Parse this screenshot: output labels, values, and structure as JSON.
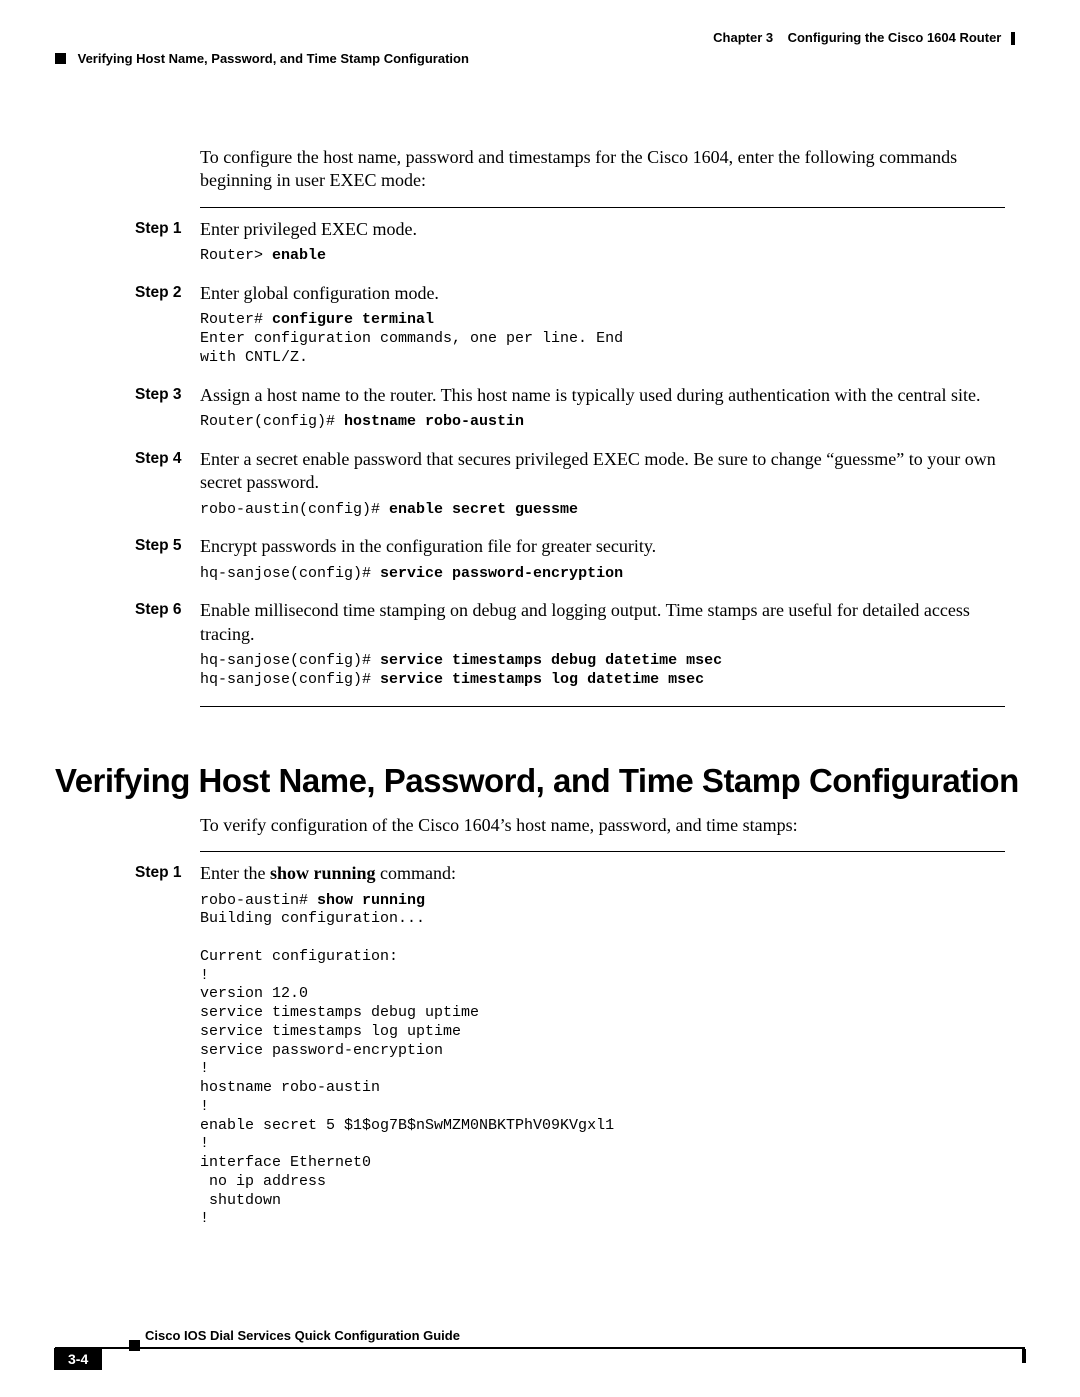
{
  "header": {
    "chapter_label": "Chapter 3",
    "chapter_title": "Configuring the Cisco 1604 Router",
    "section_crumb": "Verifying Host Name, Password, and Time Stamp Configuration"
  },
  "intro_para": "To configure the host name, password and timestamps for the Cisco 1604, enter the following commands beginning in user EXEC mode:",
  "steps1": [
    {
      "label": "Step 1",
      "text": "Enter privileged EXEC mode.",
      "code_prefix": "Router> ",
      "code_bold": "enable",
      "code_suffix": ""
    },
    {
      "label": "Step 2",
      "text": "Enter global configuration mode.",
      "code_prefix": "Router# ",
      "code_bold": "configure terminal",
      "code_suffix": "\nEnter configuration commands, one per line. End\nwith CNTL/Z."
    },
    {
      "label": "Step 3",
      "text": "Assign a host name to the router. This host name is typically used during authentication with the central site.",
      "code_prefix": "Router(config)# ",
      "code_bold": "hostname robo-austin",
      "code_suffix": ""
    },
    {
      "label": "Step 4",
      "text": "Enter a secret enable password that secures privileged EXEC mode. Be sure to change “guessme” to your own secret password.",
      "code_prefix": "robo-austin(config)# ",
      "code_bold": "enable secret guessme",
      "code_suffix": ""
    },
    {
      "label": "Step 5",
      "text": "Encrypt passwords in the configuration file for greater security.",
      "code_prefix": "hq-sanjose(config)# ",
      "code_bold": "service password-encryption",
      "code_suffix": ""
    },
    {
      "label": "Step 6",
      "text": "Enable millisecond time stamping on debug and logging output. Time stamps are useful for detailed access tracing.",
      "code_prefix": "hq-sanjose(config)# ",
      "code_bold": "service timestamps debug datetime msec",
      "code_suffix": "",
      "code2_prefix": "hq-sanjose(config)# ",
      "code2_bold": "service timestamps log datetime msec"
    }
  ],
  "section_heading": "Verifying Host Name, Password, and Time Stamp Configuration",
  "verify_para": "To verify configuration of the Cisco 1604’s host name, password, and time stamps:",
  "steps2": [
    {
      "label": "Step 1",
      "text_pre": "Enter the ",
      "text_bold": "show running",
      "text_post": " command:",
      "code_prefix": "robo-austin# ",
      "code_bold": "show running",
      "code_suffix": "\nBuilding configuration...\n\nCurrent configuration:\n!\nversion 12.0\nservice timestamps debug uptime\nservice timestamps log uptime\nservice password-encryption\n!\nhostname robo-austin\n!\nenable secret 5 $1$og7B$nSwMZM0NBKTPhV09KVgxl1\n!\ninterface Ethernet0\n no ip address\n shutdown\n!"
    }
  ],
  "footer": {
    "guide_title": "Cisco IOS Dial Services Quick Configuration Guide",
    "page_number": "3-4"
  }
}
